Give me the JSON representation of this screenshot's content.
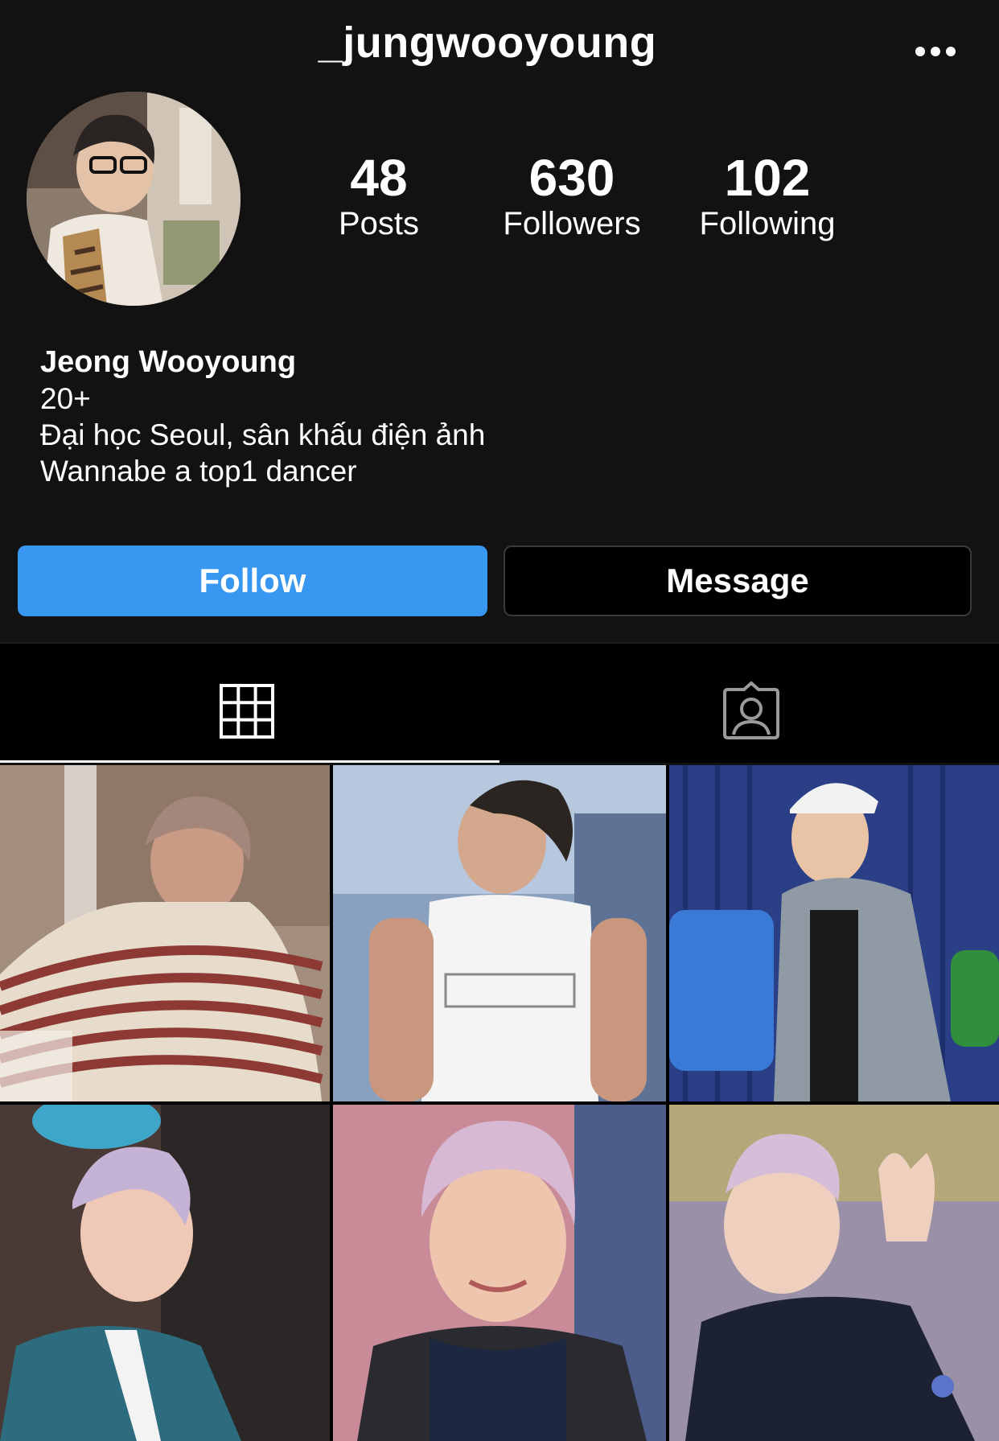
{
  "profile": {
    "username": "_jungwooyoung",
    "display_name": "Jeong Wooyoung",
    "bio_lines": [
      "20+",
      "Đại học Seoul, sân khấu điện ảnh",
      "Wannabe a top1 dancer"
    ]
  },
  "stats": {
    "posts": {
      "value": "48",
      "label": "Posts"
    },
    "followers": {
      "value": "630",
      "label": "Followers"
    },
    "following": {
      "value": "102",
      "label": "Following"
    }
  },
  "actions": {
    "follow_label": "Follow",
    "message_label": "Message"
  },
  "icons": {
    "more": "more-horizontal-icon",
    "grid_tab": "grid-icon",
    "tagged_tab": "tagged-person-icon"
  },
  "colors": {
    "accent": "#3897f0",
    "background": "#121212"
  },
  "posts_grid": {
    "rows": 2,
    "columns": 3,
    "items_visible": 6
  }
}
